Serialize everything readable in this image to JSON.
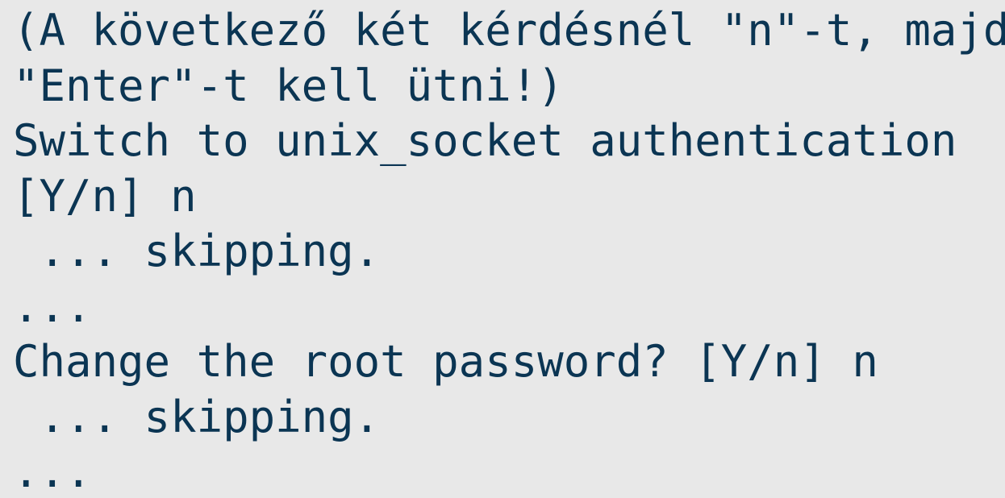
{
  "terminal": {
    "lines": [
      "(A következő két kérdésnél \"n\"-t, majd",
      "\"Enter\"-t kell ütni!)",
      "Switch to unix_socket authentication",
      "[Y/n] n",
      " ... skipping.",
      "...",
      "Change the root password? [Y/n] n",
      " ... skipping.",
      "..."
    ]
  },
  "colors": {
    "background": "#e8e8e8",
    "text": "#0b3553"
  }
}
